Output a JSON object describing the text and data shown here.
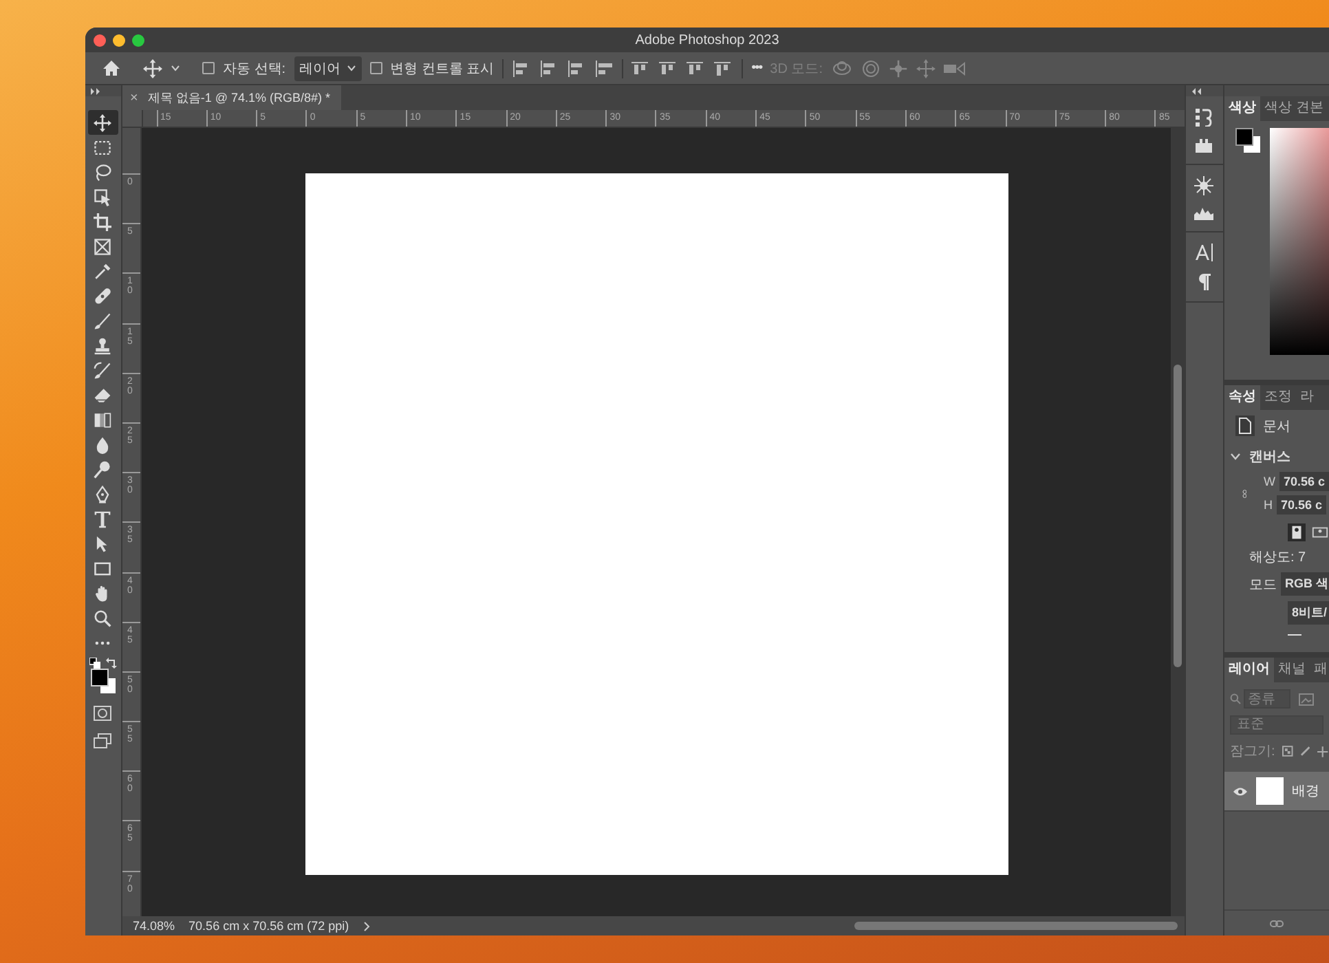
{
  "window": {
    "title": "Adobe Photoshop 2023"
  },
  "options_bar": {
    "auto_select": {
      "label": "자동 선택:",
      "checked": false
    },
    "auto_select_target": "레이어",
    "transform_controls": {
      "label": "변형 컨트롤 표시",
      "checked": false
    },
    "more": "•••",
    "mode_3d": {
      "label": "3D 모드:",
      "disabled": true
    }
  },
  "document_tab": {
    "title": "제목 없음-1 @ 74.1% (RGB/8#) *",
    "close": "×"
  },
  "rulers": {
    "horizontal": [
      "15",
      "10",
      "5",
      "0",
      "5",
      "10",
      "15",
      "20",
      "25",
      "30",
      "35",
      "40",
      "45",
      "50",
      "55",
      "60",
      "65",
      "70",
      "75",
      "80",
      "85"
    ],
    "vertical": [
      "0",
      "5",
      "10",
      "15",
      "20",
      "25",
      "30",
      "35",
      "40",
      "45",
      "50",
      "55",
      "60",
      "65",
      "70"
    ]
  },
  "tools": [
    {
      "kind": "move",
      "selected": true
    },
    {
      "kind": "marquee",
      "selected": false
    },
    {
      "kind": "lasso",
      "selected": false
    },
    {
      "kind": "object-select",
      "selected": false
    },
    {
      "kind": "crop",
      "selected": false
    },
    {
      "kind": "frame",
      "selected": false
    },
    {
      "kind": "eyedropper",
      "selected": false
    },
    {
      "kind": "healing",
      "selected": false
    },
    {
      "kind": "brush",
      "selected": false
    },
    {
      "kind": "stamp",
      "selected": false
    },
    {
      "kind": "history-brush",
      "selected": false
    },
    {
      "kind": "eraser",
      "selected": false
    },
    {
      "kind": "gradient",
      "selected": false
    },
    {
      "kind": "blur",
      "selected": false
    },
    {
      "kind": "dodge",
      "selected": false
    },
    {
      "kind": "pen",
      "selected": false
    },
    {
      "kind": "type",
      "selected": false
    },
    {
      "kind": "path-select",
      "selected": false
    },
    {
      "kind": "rectangle",
      "selected": false
    },
    {
      "kind": "hand",
      "selected": false
    },
    {
      "kind": "zoom",
      "selected": false
    },
    {
      "kind": "more",
      "selected": false
    }
  ],
  "color_panel": {
    "tabs": [
      {
        "label": "색상",
        "selected": true
      },
      {
        "label": "색상 견본",
        "selected": false
      }
    ]
  },
  "properties_panel": {
    "tabs": [
      {
        "label": "속성",
        "selected": true
      },
      {
        "label": "조정",
        "selected": false
      },
      {
        "label": "라",
        "selected": false
      }
    ],
    "document_label": "문서",
    "section": {
      "title": "캔버스",
      "expanded": true
    },
    "width": {
      "label": "W",
      "value": "70.56 c"
    },
    "height": {
      "label": "H",
      "value": "70.56 c"
    },
    "resolution": "해상도: 7",
    "mode": {
      "label": "모드",
      "value": "RGB 색"
    },
    "bit_depth": "8비트/"
  },
  "layers_panel": {
    "tabs": [
      {
        "label": "레이어",
        "selected": true
      },
      {
        "label": "채널",
        "selected": false
      },
      {
        "label": "패",
        "selected": false
      }
    ],
    "filter_placeholder": "종류",
    "blend_mode": "표준",
    "lock_label": "잠그기:",
    "layers": [
      {
        "name": "배경",
        "visible": true,
        "selected": true
      }
    ]
  },
  "status_bar": {
    "zoom": "74.08%",
    "document_size": "70.56 cm x 70.56 cm (72 ppi)"
  }
}
